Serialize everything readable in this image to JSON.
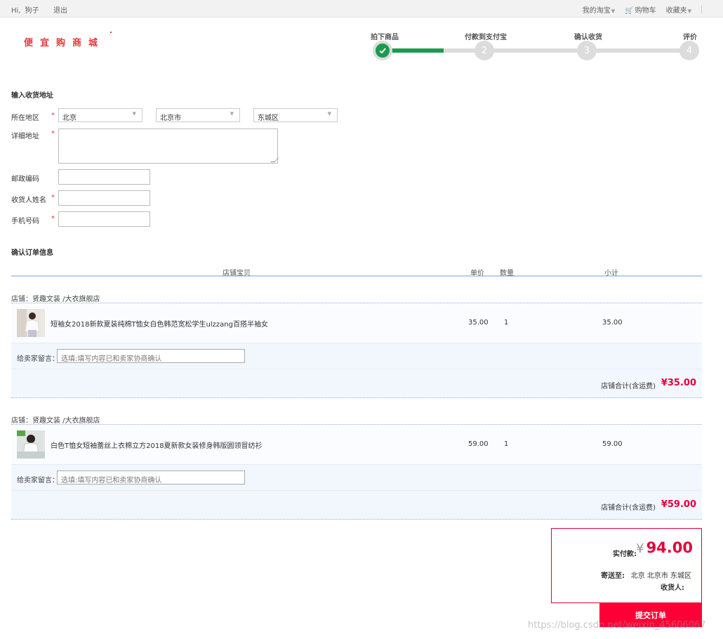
{
  "topbar": {
    "greeting": "Hi,",
    "username": "狗子",
    "logout": "退出",
    "my_taobao": "我的淘宝",
    "cart": "购物车",
    "favorites": "收藏夹"
  },
  "logo": {
    "text": "便宜购商城"
  },
  "steps": [
    {
      "label": "拍下商品",
      "number": "1",
      "done": true
    },
    {
      "label": "付款到支付宝",
      "number": "2",
      "done": false
    },
    {
      "label": "确认收货",
      "number": "3",
      "done": false
    },
    {
      "label": "评价",
      "number": "4",
      "done": false
    }
  ],
  "steps_progress": 0.2,
  "address": {
    "title": "输入收货地址",
    "region_label": "所在地区",
    "province": "北京",
    "city": "北京市",
    "district": "东城区",
    "detail_label": "详细地址",
    "zip_label": "邮政编码",
    "name_label": "收货人姓名",
    "phone_label": "手机号码",
    "required_mark": "*"
  },
  "order": {
    "title": "确认订单信息",
    "columns": {
      "item": "店铺宝贝",
      "price": "单价",
      "qty": "数量",
      "subtotal": "小计"
    },
    "shops": [
      {
        "shop_label": "店铺：贤趣文装 /大衣旗舰店",
        "item_title": "短袖女2018新款夏装纯棉T恤女白色韩范宽松学生ulzzang百搭半袖女",
        "price": "35.00",
        "qty": "1",
        "subtotal": "35.00",
        "message_label": "给卖家留言：",
        "message_placeholder": "选填:填写内容已和卖家协商确认",
        "total_label": "店铺合计(含运费)",
        "total_value": "¥35.00"
      },
      {
        "shop_label": "店铺：贤趣文装 /大衣旗舰店",
        "item_title": "白色T恤女短袖蕾丝上衣棉立方2018夏新款女装修身韩版圆领冒纺衫",
        "price": "59.00",
        "qty": "1",
        "subtotal": "59.00",
        "message_label": "给卖家留言：",
        "message_placeholder": "选填:填写内容已和卖家协商确认",
        "total_label": "店铺合计(含运费)",
        "total_value": "¥59.00"
      }
    ]
  },
  "summary": {
    "pay_label": "实付款:",
    "currency": "¥",
    "pay_amount": "94.00",
    "ship_label": "寄送至:",
    "ship_value": "北京 北京市 东城区",
    "receiver_label": "收货人:"
  },
  "submit_label": "提交订单",
  "watermark": "https://blog.csdn.net/weixin_45606067",
  "colors": {
    "accent": "#e4003a",
    "progress": "#1a9b4e",
    "submit": "#ff0036"
  }
}
